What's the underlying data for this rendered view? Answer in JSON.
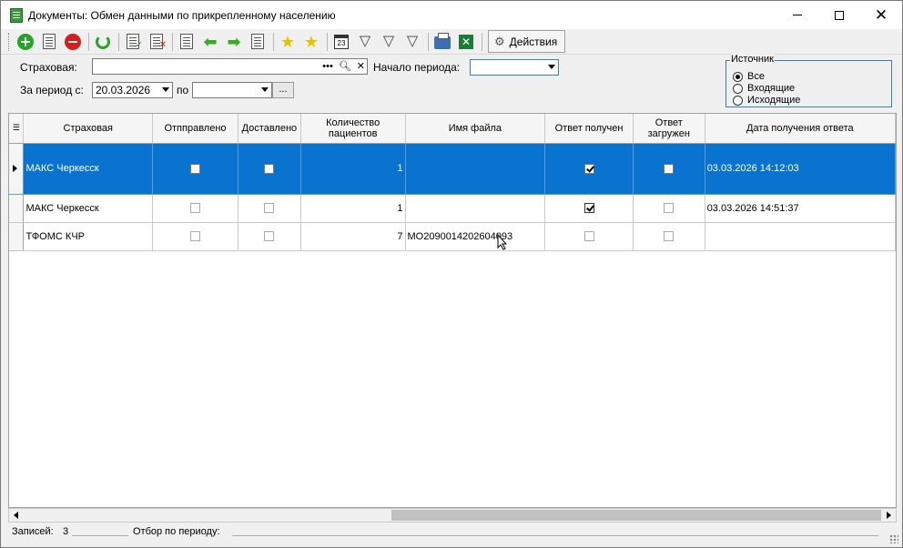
{
  "window": {
    "title": "Документы: Обмен данными по прикрепленному населению",
    "controls": [
      "minimize",
      "maximize",
      "close"
    ]
  },
  "toolbar": {
    "actions_label": "Действия",
    "icons": [
      "add-icon",
      "document-icon",
      "delete-icon",
      "refresh-icon",
      "check-document-icon",
      "cancel-document-icon",
      "select-icon",
      "arrow-left-icon",
      "arrow-right-icon",
      "select-right-icon",
      "star-add-icon",
      "star-arrow-icon",
      "calendar-icon",
      "filter-icon",
      "filter-edit-icon",
      "filter-clear-icon",
      "print-icon",
      "excel-icon",
      "gear-icon"
    ]
  },
  "filters": {
    "insurer_label": "Страховая:",
    "insurer_value": "",
    "period_start_label": "Начало периода:",
    "period_start_value": "",
    "period_from_label": "За период с:",
    "period_from_value": "20.03.2026",
    "period_to_label": "по",
    "period_to_value": "",
    "dots": "..."
  },
  "source": {
    "legend": "Источник",
    "options": [
      "Все",
      "Входящие",
      "Исходящие"
    ],
    "selected": "Все"
  },
  "table": {
    "columns": [
      "Страховая",
      "Отпправлено",
      "Доставлено",
      "Количество пациентов",
      "Имя файла",
      "Ответ получен",
      "Ответ загружен",
      "Дата получения ответа"
    ],
    "rows": [
      {
        "insurer": "МАКС Черкесск",
        "sent": false,
        "delivered": false,
        "count": "1",
        "file": "",
        "answer_received": true,
        "answer_loaded": false,
        "answer_date": "03.03.2026 14:12:03",
        "selected": true
      },
      {
        "insurer": "МАКС Черкесск",
        "sent": false,
        "delivered": false,
        "count": "1",
        "file": "",
        "answer_received": true,
        "answer_loaded": false,
        "answer_date": "03.03.2026 14:51:37",
        "selected": false
      },
      {
        "insurer": "ТФОМС КЧР",
        "sent": false,
        "delivered": false,
        "count": "7",
        "file": "MO2090014202604093",
        "answer_received": false,
        "answer_loaded": false,
        "answer_date": "",
        "selected": false
      }
    ]
  },
  "status": {
    "records_label": "Записей:",
    "records_count": "3",
    "filter_label": "Отбор по периоду:"
  }
}
